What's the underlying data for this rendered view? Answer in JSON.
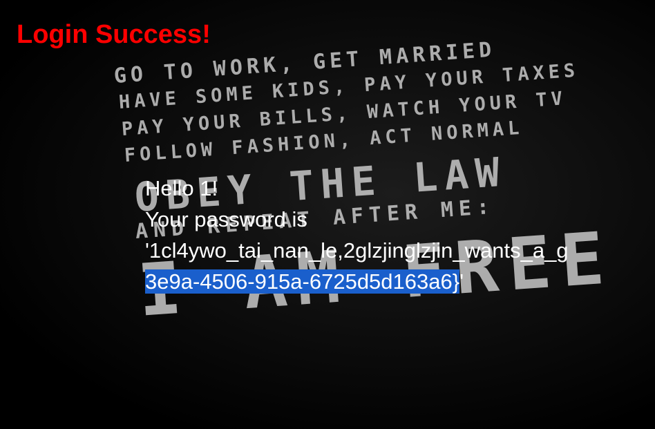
{
  "header": {
    "title": "Login Success!",
    "title_color": "#ff0000"
  },
  "background": {
    "lines": [
      "Go to work, get married",
      "Have some kids, pay your taxes",
      "Pay your bills, watch your TV",
      "Follow fashion, act normal",
      "Obey the law",
      "And repeat after me:",
      "I am free"
    ]
  },
  "message": {
    "greeting": "Hello 1!",
    "password_label": "Your password is",
    "password_line1": "'1cl4ywo_tai_nan_le,2glzjinglzjin_wants_a_g",
    "password_line2_selected": "3e9a-4506-915a-6725d5d163a6}",
    "password_line2_rest": "'",
    "selection_color": "#1a5fcc"
  }
}
